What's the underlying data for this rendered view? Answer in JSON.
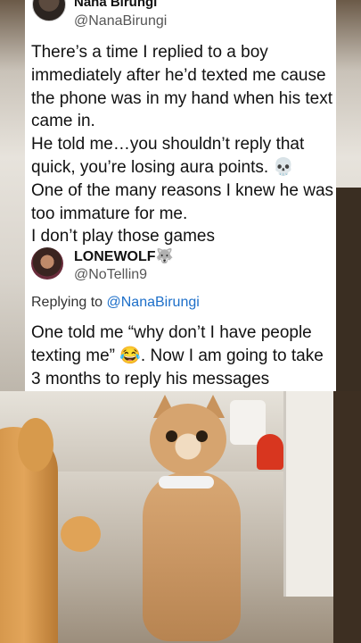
{
  "tweet1": {
    "name": "Nana Birungi",
    "handle": "@NanaBirungi",
    "body": "There’s a time I replied to a boy immediately after he’d texted me  cause the phone was in my hand when his text came in.\nHe told me…you shouldn’t reply that quick, you’re losing aura points. 💀\nOne of the many reasons I knew he was too immature for me.\nI don’t play those games"
  },
  "tweet2": {
    "name": "LONEWOLF🐺",
    "handle": "@NoTellin9",
    "replying_prefix": "Replying to ",
    "replying_handle": "@NanaBirungi",
    "body": "One told me “why don’t I have people texting me” 😂. Now I am going to take 3 months to reply his messages"
  },
  "colors": {
    "mention": "#1d6fc9",
    "card_bg": "#ffffff"
  }
}
